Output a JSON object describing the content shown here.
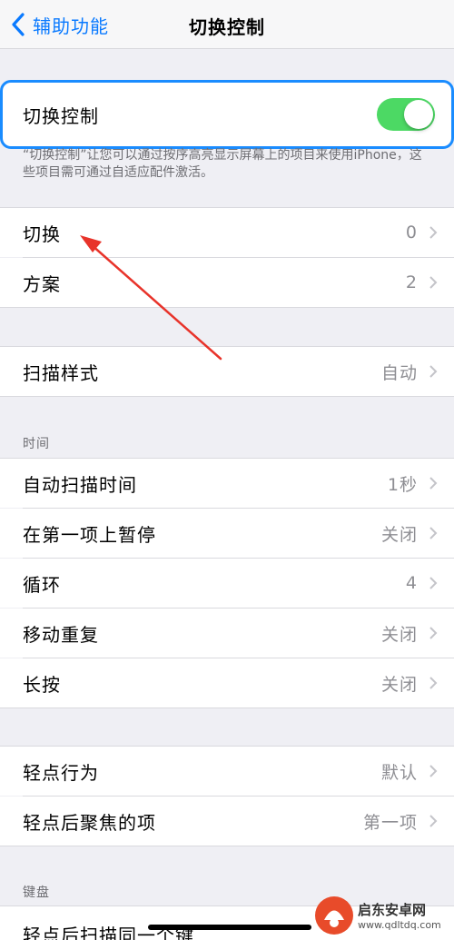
{
  "nav": {
    "back_label": "辅助功能",
    "title": "切换控制"
  },
  "switch_control": {
    "label": "切换控制",
    "enabled": true,
    "color": "#4cd964",
    "highlight_color": "#1a8cff"
  },
  "note": "“切换控制”让您可以通过按序高亮显示屏幕上的项目来使用iPhone，这些项目需可通过自适应配件激活。",
  "group1": [
    {
      "label": "切换",
      "value": "0"
    },
    {
      "label": "方案",
      "value": "2"
    }
  ],
  "group2": [
    {
      "label": "扫描样式",
      "value": "自动"
    }
  ],
  "time_section": {
    "header": "时间",
    "items": [
      {
        "label": "自动扫描时间",
        "value": "1秒"
      },
      {
        "label": "在第一项上暂停",
        "value": "关闭"
      },
      {
        "label": "循环",
        "value": "4"
      },
      {
        "label": "移动重复",
        "value": "关闭"
      },
      {
        "label": "长按",
        "value": "关闭"
      }
    ]
  },
  "group4": [
    {
      "label": "轻点行为",
      "value": "默认"
    },
    {
      "label": "轻点后聚焦的项",
      "value": "第一项"
    }
  ],
  "keyboard_section": {
    "header": "键盘",
    "items": [
      {
        "label": "轻点后扫描同一个键"
      }
    ]
  },
  "watermark": {
    "name": "启东安卓网",
    "url": "www.qdltdq.com"
  },
  "colors": {
    "accent": "#0a7aff",
    "arrow": "#e8332a"
  }
}
